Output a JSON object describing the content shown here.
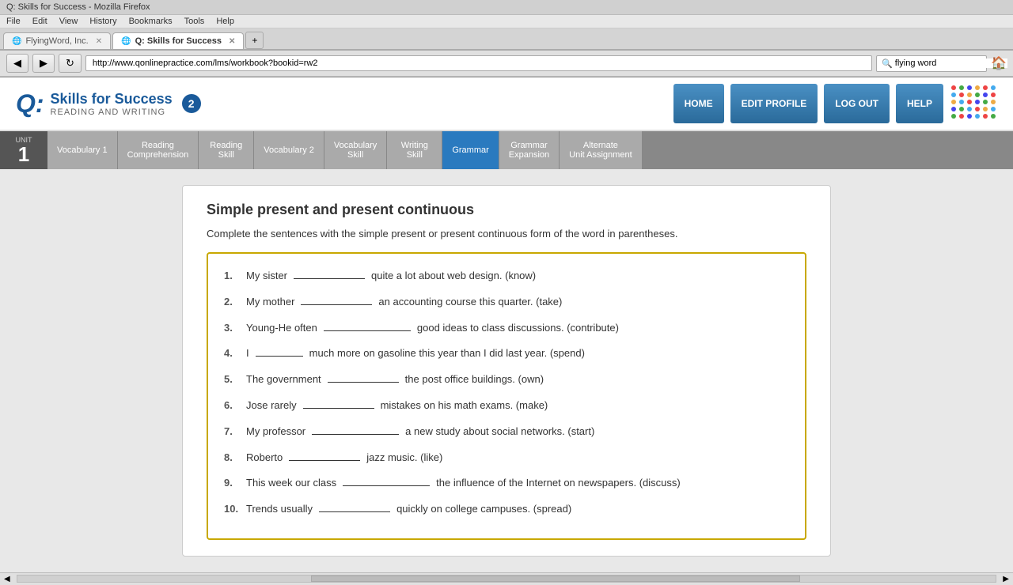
{
  "browser": {
    "title": "Q: Skills for Success - Mozilla Firefox",
    "tabs": [
      {
        "label": "FlyingWord, Inc.",
        "active": false
      },
      {
        "label": "Q: Skills for Success",
        "active": true
      }
    ],
    "address": "http://www.qonlinepractice.com/lms/workbook?bookid=rw2",
    "search_value": "flying word"
  },
  "menu": {
    "items": [
      "File",
      "Edit",
      "View",
      "History",
      "Bookmarks",
      "Tools",
      "Help"
    ]
  },
  "header": {
    "logo_q": "Q:",
    "logo_title": "Skills for Success",
    "logo_subtitle": "READING AND WRITING",
    "logo_badge": "2",
    "buttons": [
      "HOME",
      "EDIT PROFILE",
      "LOG OUT",
      "HELP"
    ]
  },
  "unit_nav": {
    "unit_label": "UNIT",
    "unit_number": "1",
    "tabs": [
      {
        "label": "Vocabulary 1",
        "active": false
      },
      {
        "label": "Reading\nComprehension",
        "active": false
      },
      {
        "label": "Reading\nSkill",
        "active": false
      },
      {
        "label": "Vocabulary 2",
        "active": false
      },
      {
        "label": "Vocabulary\nSkill",
        "active": false
      },
      {
        "label": "Writing\nSkill",
        "active": false
      },
      {
        "label": "Grammar",
        "active": true
      },
      {
        "label": "Grammar\nExpansion",
        "active": false
      },
      {
        "label": "Alternate\nUnit Assignment",
        "active": false
      }
    ]
  },
  "exercise": {
    "title": "Simple present and present continuous",
    "instruction": "Complete the sentences with the simple present or present continuous form of the word in parentheses.",
    "items": [
      {
        "num": "1.",
        "parts": [
          "My sister",
          "blank_med",
          "quite a lot about web design. (know)"
        ]
      },
      {
        "num": "2.",
        "parts": [
          "My mother",
          "blank_med",
          "an accounting course this quarter. (take)"
        ]
      },
      {
        "num": "3.",
        "parts": [
          "Young-He often",
          "blank_med",
          "good ideas to class discussions. (contribute)"
        ]
      },
      {
        "num": "4.",
        "parts": [
          "I",
          "blank_short",
          "much more on gasoline this year than I did last year. (spend)"
        ]
      },
      {
        "num": "5.",
        "parts": [
          "The government",
          "blank_med",
          "the post office buildings. (own)"
        ]
      },
      {
        "num": "6.",
        "parts": [
          "Jose rarely",
          "blank_med",
          "mistakes on his math exams. (make)"
        ]
      },
      {
        "num": "7.",
        "parts": [
          "My professor",
          "blank_med",
          "a new study about social networks. (start)"
        ]
      },
      {
        "num": "8.",
        "parts": [
          "Roberto",
          "blank_med",
          "jazz music. (like)"
        ]
      },
      {
        "num": "9.",
        "parts": [
          "This week our class",
          "blank_long",
          "the influence of the Internet on newspapers. (discuss)"
        ]
      },
      {
        "num": "10.",
        "parts": [
          "Trends usually",
          "blank_med",
          "quickly on college campuses. (spread)"
        ]
      }
    ]
  }
}
